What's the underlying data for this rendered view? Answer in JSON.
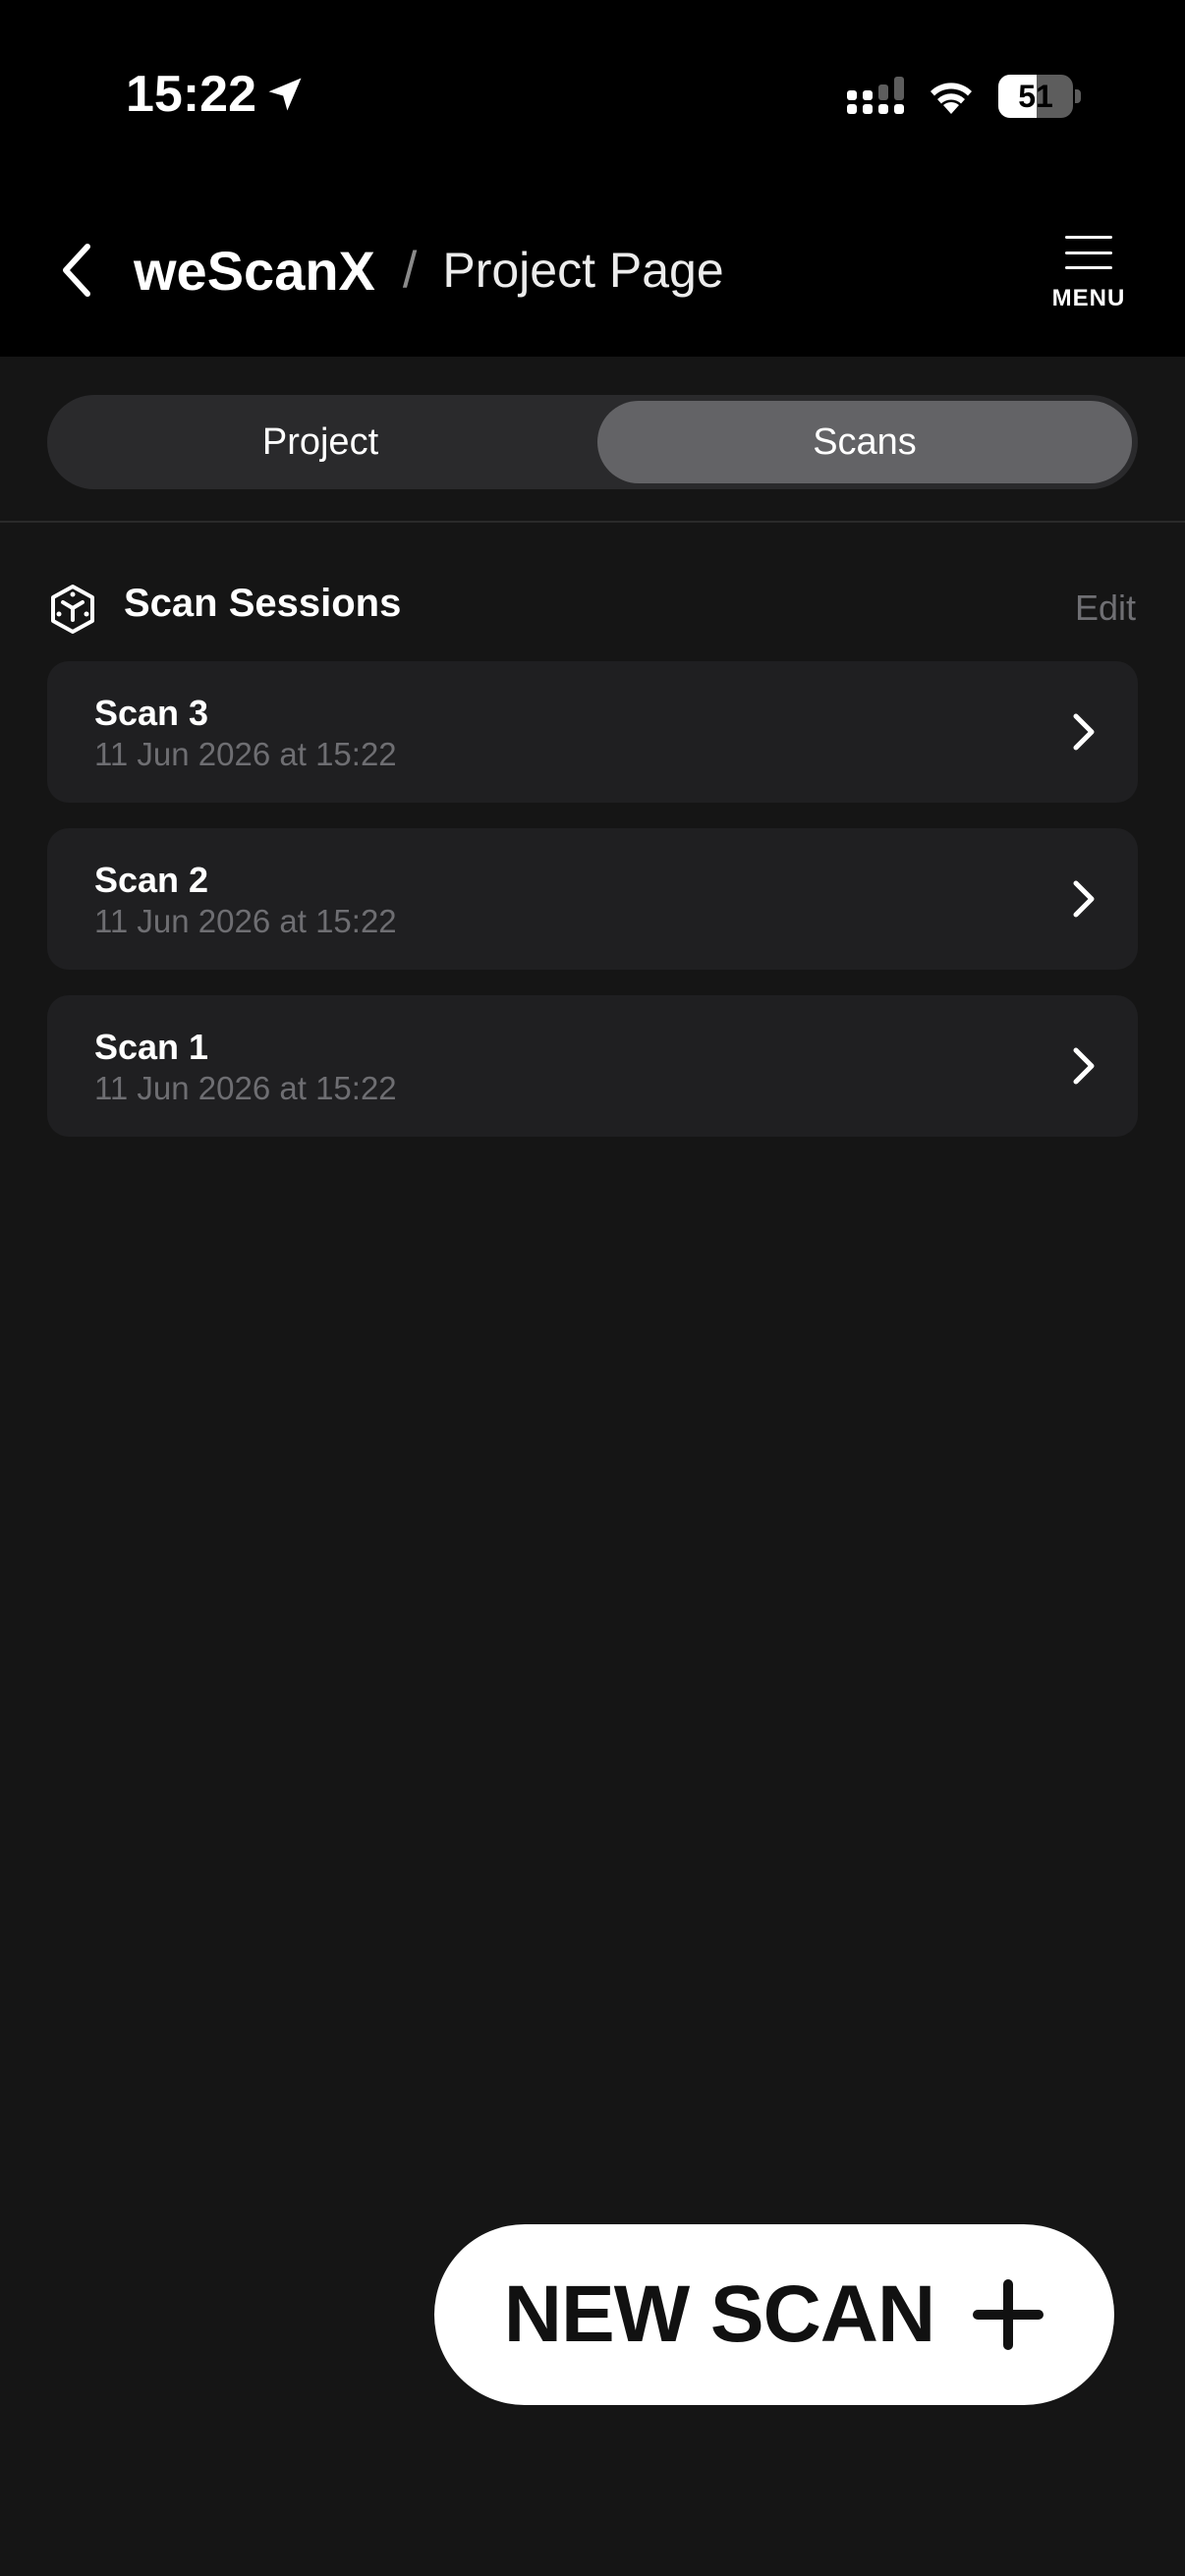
{
  "status_bar": {
    "time": "15:22",
    "battery_level": 51,
    "battery_text": "51",
    "icons": [
      "location-arrow-icon",
      "cellular-signal-icon",
      "wifi-icon",
      "battery-icon"
    ]
  },
  "header": {
    "back_icon": "chevron-left-icon",
    "app_name": "weScanX",
    "separator": "/",
    "page_title": "Project Page",
    "menu_icon": "hamburger-icon",
    "menu_label": "MENU"
  },
  "tabs": {
    "items": [
      {
        "label": "Project",
        "selected": false
      },
      {
        "label": "Scans",
        "selected": true
      }
    ]
  },
  "section": {
    "icon": "cube-icon",
    "title": "Scan Sessions",
    "edit_label": "Edit"
  },
  "scans": [
    {
      "name": "Scan 3",
      "date": "11 Jun 2026 at 15:22"
    },
    {
      "name": "Scan 2",
      "date": "11 Jun 2026 at 15:22"
    },
    {
      "name": "Scan 1",
      "date": "11 Jun 2026 at 15:22"
    }
  ],
  "fab": {
    "label": "NEW SCAN",
    "icon": "plus-icon"
  },
  "colors": {
    "background": "#151515",
    "header_background": "#000000",
    "segmented_track": "#2a2a2c",
    "segmented_selected": "#636366",
    "row_background": "#1f1f21",
    "secondary_text": "#6e6e72",
    "fab_background": "#ffffff"
  }
}
